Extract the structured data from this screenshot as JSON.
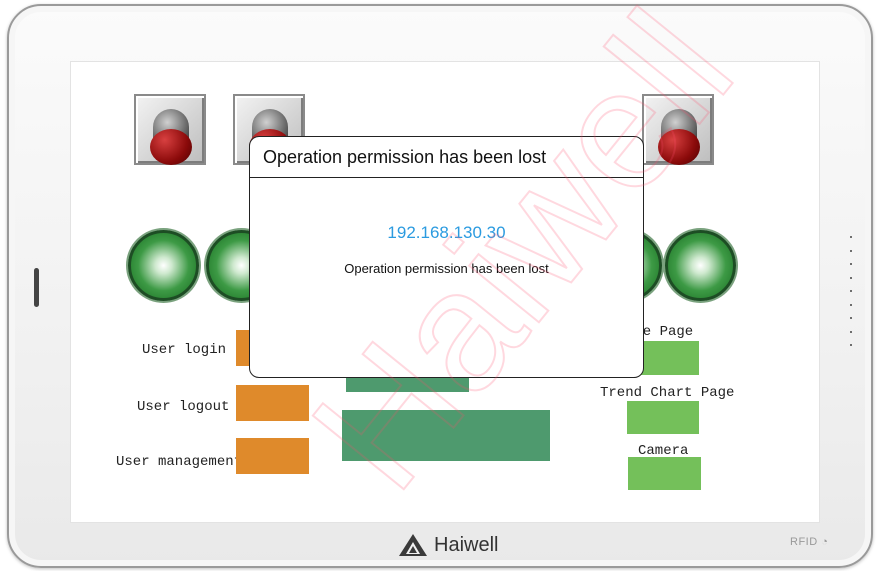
{
  "hmi": {
    "labels": {
      "user_login": "User login",
      "user_logout": "User logout",
      "user_management": "User management",
      "recipe_page": "ipe Page",
      "trend_chart_page": "Trend Chart Page",
      "camera": "Camera"
    }
  },
  "dialog": {
    "title": "Operation permission has been lost",
    "ip": "192.168.130.30",
    "message": "Operation permission has been lost"
  },
  "brand": {
    "name": "Haiwell",
    "rfid": "RFID"
  },
  "watermark": "Haiwell",
  "colors": {
    "orange_button": "#df8a2b",
    "green_button": "#74c05a",
    "dark_green_bar": "#4e9a6e",
    "ip_blue": "#2b9be0"
  }
}
